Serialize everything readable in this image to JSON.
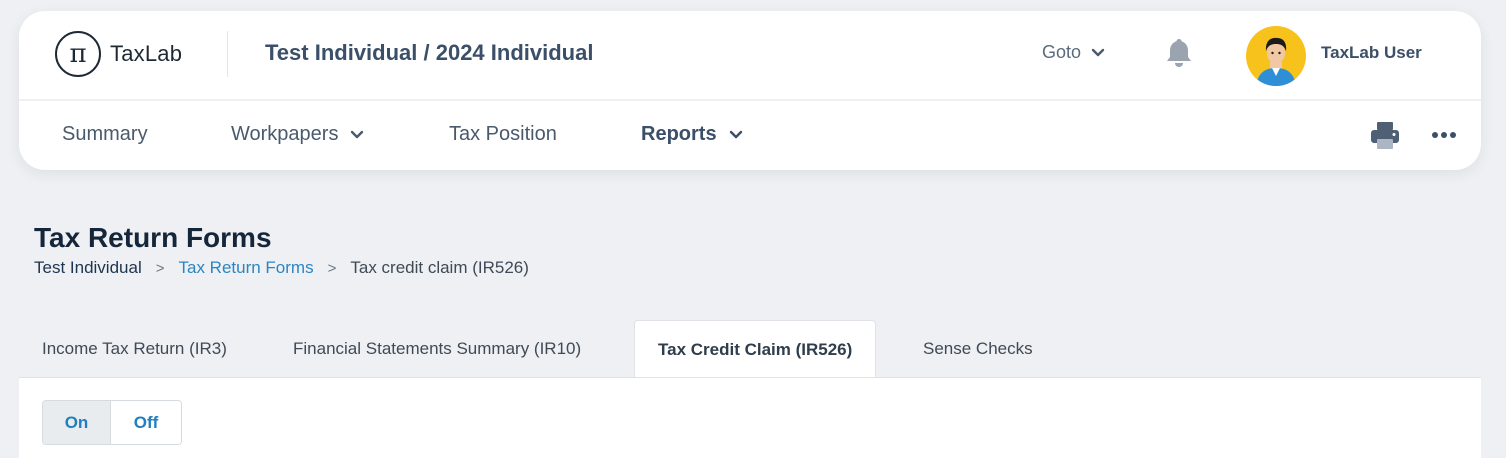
{
  "app": {
    "logo_text": "TaxLab",
    "logo_glyph": "π"
  },
  "header": {
    "context_title": "Test Individual / 2024 Individual",
    "goto_label": "Goto",
    "user_name": "TaxLab User"
  },
  "nav": {
    "items": [
      {
        "label": "Summary",
        "has_dropdown": false
      },
      {
        "label": "Workpapers",
        "has_dropdown": true
      },
      {
        "label": "Tax Position",
        "has_dropdown": false
      },
      {
        "label": "Reports",
        "has_dropdown": true,
        "active": true
      }
    ]
  },
  "page": {
    "title": "Tax Return Forms",
    "breadcrumb": [
      "Test Individual",
      "Tax Return Forms",
      "Tax credit claim (IR526)"
    ],
    "breadcrumb_separator": ">"
  },
  "tabs": [
    {
      "label": "Income Tax Return (IR3)"
    },
    {
      "label": "Financial Statements Summary (IR10)"
    },
    {
      "label": "Tax Credit Claim (IR526)",
      "active": true
    },
    {
      "label": "Sense Checks"
    }
  ],
  "toggle": {
    "on_label": "On",
    "off_label": "Off",
    "selected": "On"
  },
  "colors": {
    "accent": "#2a86c3",
    "avatar_bg": "#f7c21b",
    "background": "#eef0f3"
  }
}
